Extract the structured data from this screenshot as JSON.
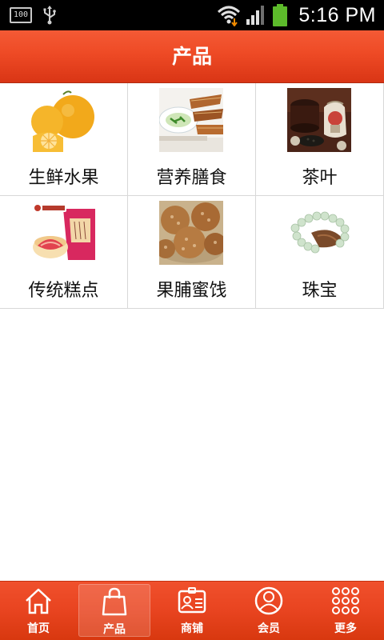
{
  "status_bar": {
    "battery_level": "100",
    "time": "5:16 PM"
  },
  "header": {
    "title": "产品"
  },
  "products": [
    {
      "label": "生鲜水果",
      "image": "citrus-fruit-image"
    },
    {
      "label": "营养膳食",
      "image": "fish-dish-image"
    },
    {
      "label": "茶叶",
      "image": "tea-set-image"
    },
    {
      "label": "传统糕点",
      "image": "pastry-package-image"
    },
    {
      "label": "果脯蜜饯",
      "image": "dried-fruit-image"
    },
    {
      "label": "珠宝",
      "image": "jade-bracelet-image"
    }
  ],
  "tabbar": {
    "tabs": [
      {
        "label": "首页",
        "icon": "home-icon",
        "active": false
      },
      {
        "label": "产品",
        "icon": "shopping-bag-icon",
        "active": true
      },
      {
        "label": "商铺",
        "icon": "shop-id-card-icon",
        "active": false
      },
      {
        "label": "会员",
        "icon": "member-person-icon",
        "active": false
      },
      {
        "label": "更多",
        "icon": "more-grid-icon",
        "active": false
      }
    ]
  },
  "colors": {
    "header_red": "#ee4a25",
    "tabbar_red": "#e84420",
    "status_bar": "#000000",
    "battery_green": "#5dbb2b"
  }
}
